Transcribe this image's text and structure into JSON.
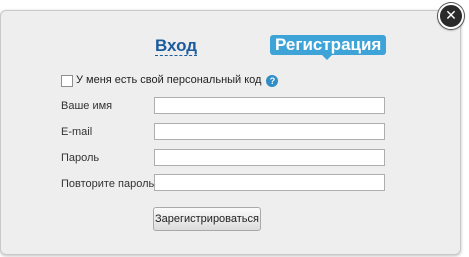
{
  "close": {
    "icon": "close-icon",
    "glyph": "✕"
  },
  "tabs": {
    "login_label": "Вход",
    "register_label": "Регистрация"
  },
  "personal_code": {
    "label": "У меня есть свой персональный код",
    "checked": false,
    "help_glyph": "?"
  },
  "fields": {
    "name_label": "Ваше имя",
    "email_label": "E-mail",
    "password_label": "Пароль",
    "password_repeat_label": "Повторите пароль"
  },
  "submit_label": "Зарегистрироваться",
  "colors": {
    "accent": "#3ea3d6",
    "link": "#1a5c9e",
    "panel_bg": "#efeeee"
  }
}
